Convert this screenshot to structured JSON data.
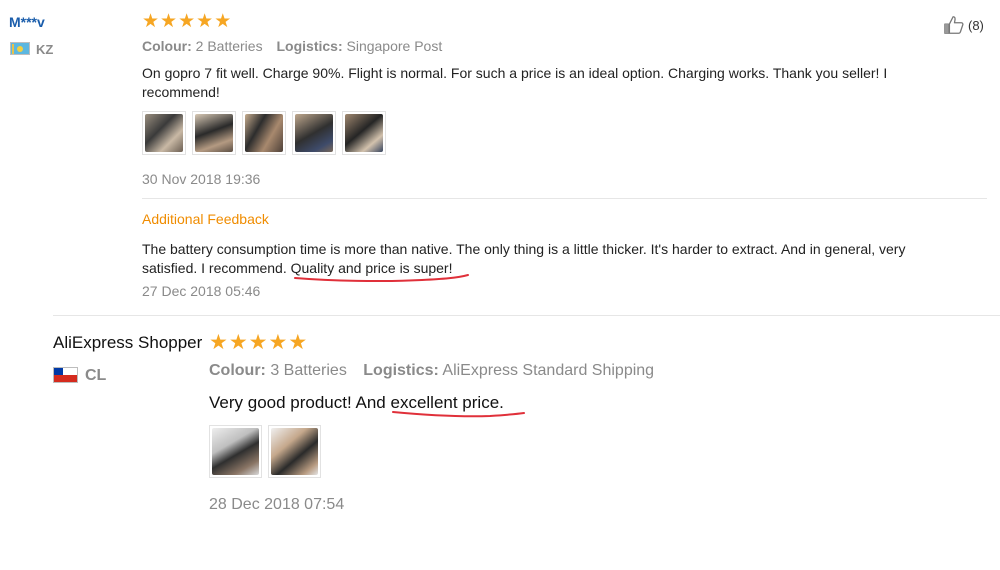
{
  "review1": {
    "username": "M***v",
    "country": "KZ",
    "rating": 5,
    "colour_label": "Colour:",
    "colour_value": "2 Batteries",
    "logistics_label": "Logistics:",
    "logistics_value": "Singapore Post",
    "text_line1": "On gopro 7 fit well. Charge 90%. Flight is normal. For such a price is an ideal option. Charging works. Thank you seller! I",
    "text_line2": "recommend!",
    "photo_count": 5,
    "date": "30 Nov 2018 19:36",
    "helpful_count": "(8)",
    "additional_feedback_title": "Additional Feedback",
    "additional_line1": "The battery consumption time is more than native. The only thing is a little thicker. It's harder to extract. And in general, very",
    "additional_line2_prefix": "satisfied. I recommend.",
    "additional_line2_highlight": "Quality and price is super!",
    "additional_date": "27 Dec 2018 05:46"
  },
  "review2": {
    "username": "AliExpress Shopper",
    "country": "CL",
    "rating": 5,
    "colour_label": "Colour:",
    "colour_value": "3 Batteries",
    "logistics_label": "Logistics:",
    "logistics_value": "AliExpress Standard Shipping",
    "text_prefix": "Very good product! And",
    "text_highlight": "excellent price.",
    "photo_count": 2,
    "date": "28 Dec 2018 07:54"
  },
  "colors": {
    "star": "#f6a623",
    "username_link": "#1a5dab",
    "additional_title": "#f08c00",
    "annotation": "#e0303a"
  }
}
